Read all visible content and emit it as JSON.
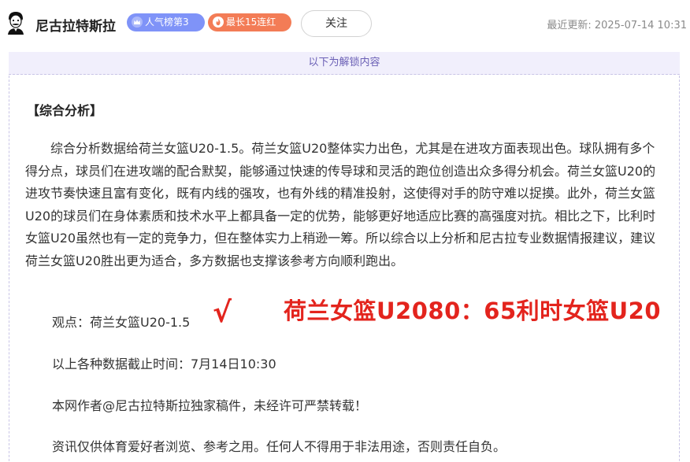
{
  "header": {
    "author_name": "尼古拉特斯拉",
    "badge_popularity": "人气榜第3",
    "badge_streak": "最长15连红",
    "follow_label": "关注",
    "updated_label": "最近更新:",
    "updated_time": "2025-07-14 10:31"
  },
  "unlock": {
    "banner": "以下为解锁内容"
  },
  "article": {
    "section_title": "【综合分析】",
    "analysis": "综合分析数据给荷兰女篮U20-1.5。荷兰女篮U20整体实力出色，尤其是在进攻方面表现出色。球队拥有多个得分点，球员们在进攻端的配合默契，能够通过快速的传导球和灵活的跑位创造出众多得分机会。荷兰女篮U20的进攻节奏快速且富有变化，既有内线的强攻，也有外线的精准投射，这使得对手的防守难以捉摸。此外，荷兰女篮U20的球员们在身体素质和技术水平上都具备一定的优势，能够更好地适应比赛的高强度对抗。相比之下，比利时女篮U20虽然也有一定的竞争力，但在整体实力上稍逊一筹。所以综合以上分析和尼古拉专业数据情报建议，建议荷兰女篮U20胜出更为适合，多方数据也支撑该参考方向顺利跑出。",
    "viewpoint": "观点：荷兰女篮U20-1.5",
    "result_mark": "√",
    "final_score": "荷兰女篮U2080：65利时女篮U20",
    "cutoff": "以上各种数据截止时间：7月14日10:30",
    "copyright": "本网作者@尼古拉特斯拉独家稿件，未经许可严禁转载！",
    "disclaimer": "资讯仅供体育爱好者浏览、参考之用。任何人不得用于非法用途，否则责任自负。"
  },
  "colors": {
    "badge_blue": "#7f93f8",
    "badge_orange": "#f37c56",
    "accent_red": "#e3241d",
    "unlock_bg": "#f1effc",
    "unlock_text": "#6a5fb5"
  },
  "icons": {
    "avatar": "tesla-portrait-icon",
    "popularity": "crown-icon",
    "streak": "flame-icon"
  }
}
